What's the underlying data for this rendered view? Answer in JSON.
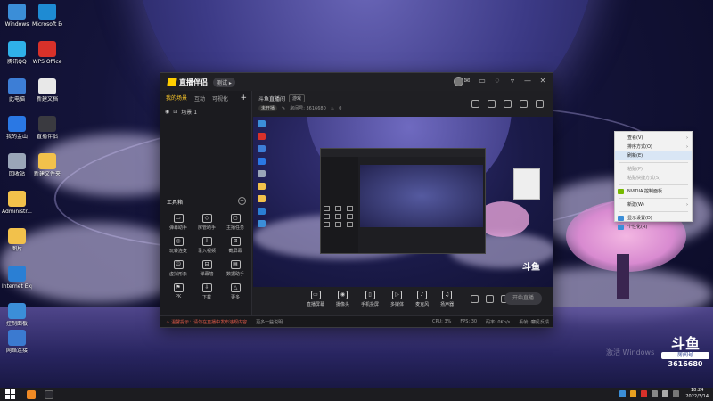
{
  "desktop": {
    "icons": [
      {
        "label": "Windows",
        "color": "#3b8ed8"
      },
      {
        "label": "Microsoft Edge",
        "color": "#1e8bd3"
      },
      {
        "label": "腾讯QQ",
        "color": "#2fb0e8"
      },
      {
        "label": "WPS Office",
        "color": "#d8312a"
      },
      {
        "label": "此电脑",
        "color": "#3d7ed6"
      },
      {
        "label": "新建文档",
        "color": "#e8e8e8"
      },
      {
        "label": "我的金山",
        "color": "#2a78e4"
      },
      {
        "label": "直播伴侣",
        "color": "#3a3a40"
      },
      {
        "label": "回收站",
        "color": "#9aa6b8"
      },
      {
        "label": "新建文件夹",
        "color": "#f2c14b"
      },
      {
        "label": "Administr...",
        "color": "#f2c14b"
      },
      {
        "label": "图片",
        "color": "#f2c14b"
      },
      {
        "label": "Internet Explorer",
        "color": "#2a7fd4"
      },
      {
        "label": "控制面板",
        "color": "#3b8ed8"
      },
      {
        "label": "网络连接",
        "color": "#3b7ad0"
      }
    ],
    "watermark": "激活 Windows"
  },
  "app": {
    "name": "直播伴侣",
    "version": "测试 ▸",
    "tabs": [
      "我的场景",
      "互动",
      "可视化"
    ],
    "scene": "场景 1",
    "toolbox_title": "工具箱",
    "toolbox_add": "+",
    "tools": [
      {
        "label": "弹幕助手",
        "glyph": "▭"
      },
      {
        "label": "房管助手",
        "glyph": "◇"
      },
      {
        "label": "主播任务",
        "glyph": "▢"
      },
      {
        "label": "玩转连麦",
        "glyph": "◎"
      },
      {
        "label": "录入视频",
        "glyph": "⇩"
      },
      {
        "label": "截屏幕",
        "glyph": "⊞"
      },
      {
        "label": "虚拟形象",
        "glyph": "☺"
      },
      {
        "label": "弹幕墙",
        "glyph": "⊟"
      },
      {
        "label": "数据助手",
        "glyph": "▤"
      },
      {
        "label": "PK",
        "glyph": "⚑"
      },
      {
        "label": "下载",
        "glyph": "⇩"
      },
      {
        "label": "更多",
        "glyph": "△"
      }
    ],
    "room": {
      "title": "斗鱼直播间",
      "tag": "游戏",
      "state": "未开播",
      "room_label": "房间号: 3616680",
      "fans": "0"
    },
    "controls": [
      {
        "label": "直播屏幕",
        "glyph": "▭"
      },
      {
        "label": "摄像头",
        "glyph": "◉"
      },
      {
        "label": "手机投屏",
        "glyph": "▯"
      },
      {
        "label": "多媒体",
        "glyph": "▷"
      },
      {
        "label": "麦克风",
        "glyph": "♪"
      },
      {
        "label": "扬声器",
        "glyph": "♫"
      }
    ],
    "start_button": "开始直播",
    "status": {
      "warning": "⚠ 温馨提示：请勿在直播中发布违规内容",
      "link": "更多一些说明",
      "cpu": "CPU: 3%",
      "fps": "FPS: 30",
      "rate": "码率: 0Kb/s",
      "drop": "丢帧: 0%",
      "feedback": "意见反馈"
    }
  },
  "context_menu": {
    "items": [
      {
        "label": "查看(V)",
        "arrow": true,
        "disabled": false
      },
      {
        "label": "排序方式(O)",
        "arrow": true,
        "disabled": false
      },
      {
        "label": "刷新(E)",
        "arrow": false,
        "disabled": false,
        "highlight": true
      },
      {
        "sep": true
      },
      {
        "label": "粘贴(P)",
        "arrow": false,
        "disabled": true
      },
      {
        "label": "粘贴快捷方式(S)",
        "arrow": false,
        "disabled": true
      },
      {
        "sep": true
      },
      {
        "label": "NVIDIA 控制面板",
        "arrow": false,
        "disabled": false,
        "icon": "#76b900"
      },
      {
        "sep": true
      },
      {
        "label": "新建(W)",
        "arrow": true,
        "disabled": false
      },
      {
        "sep": true
      },
      {
        "label": "显示设置(D)",
        "arrow": false,
        "disabled": false,
        "icon": "#3b8ed8"
      },
      {
        "label": "个性化(R)",
        "arrow": false,
        "disabled": false,
        "icon": "#3b8ed8"
      }
    ]
  },
  "douyu": {
    "logo": "斗鱼",
    "label": "房间号",
    "room": "3616680"
  },
  "taskbar": {
    "time": "18:24",
    "date": "2022/3/14"
  }
}
